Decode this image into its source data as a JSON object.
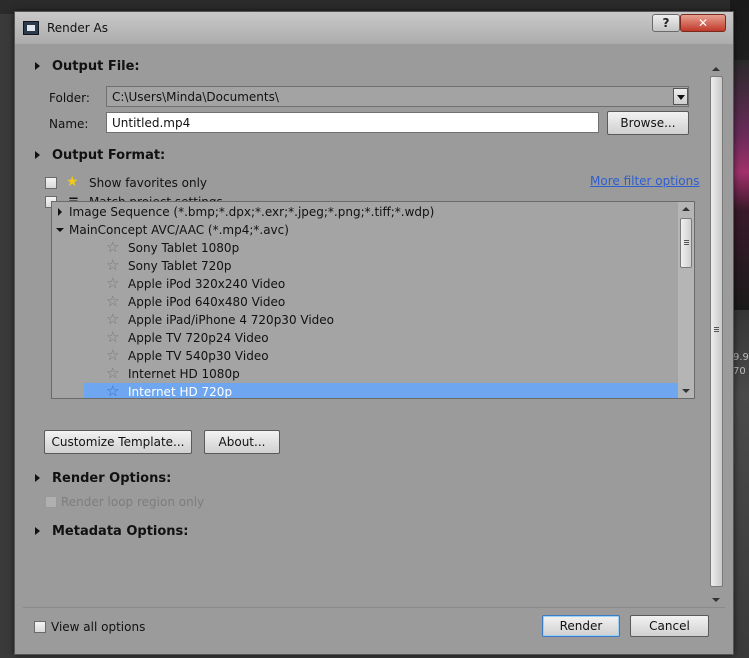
{
  "window": {
    "title": "Render As",
    "help_label": "?",
    "close_label": "✕"
  },
  "output_file": {
    "heading": "Output File:",
    "folder_label": "Folder:",
    "folder_value": "C:\\Users\\Minda\\Documents\\",
    "name_label": "Name:",
    "name_value": "Untitled.mp4",
    "browse_label": "Browse..."
  },
  "output_format": {
    "heading": "Output Format:",
    "show_favorites_label": "Show favorites only",
    "match_project_label": "Match project settings",
    "more_filter_label": "More filter options",
    "formats": [
      {
        "type": "group",
        "label": "Image Sequence (*.bmp;*.dpx;*.exr;*.jpeg;*.png;*.tiff;*.wdp)",
        "expanded": false
      },
      {
        "type": "group",
        "label": "MainConcept AVC/AAC (*.mp4;*.avc)",
        "expanded": true
      },
      {
        "type": "template",
        "label": "Sony Tablet 1080p"
      },
      {
        "type": "template",
        "label": "Sony Tablet 720p"
      },
      {
        "type": "template",
        "label": "Apple iPod 320x240 Video"
      },
      {
        "type": "template",
        "label": "Apple iPod 640x480 Video"
      },
      {
        "type": "template",
        "label": "Apple iPad/iPhone 4 720p30 Video"
      },
      {
        "type": "template",
        "label": "Apple TV 720p24 Video"
      },
      {
        "type": "template",
        "label": "Apple TV 540p30 Video"
      },
      {
        "type": "template",
        "label": "Internet HD 1080p"
      },
      {
        "type": "template",
        "label": "Internet HD 720p",
        "selected": true
      }
    ],
    "customize_label": "Customize Template...",
    "about_label": "About..."
  },
  "render_options": {
    "heading": "Render Options:",
    "loop_region_label": "Render loop region only"
  },
  "metadata_options": {
    "heading": "Metadata Options:"
  },
  "footer": {
    "view_all_label": "View all options",
    "render_label": "Render",
    "cancel_label": "Cancel"
  },
  "background": {
    "text_1": "9.9",
    "text_2": "70"
  },
  "colors": {
    "dialog_bg": "#9b9b9b",
    "selection": "#6fa6f0",
    "link": "#2d5fd0",
    "close_red": "#c0392b"
  }
}
